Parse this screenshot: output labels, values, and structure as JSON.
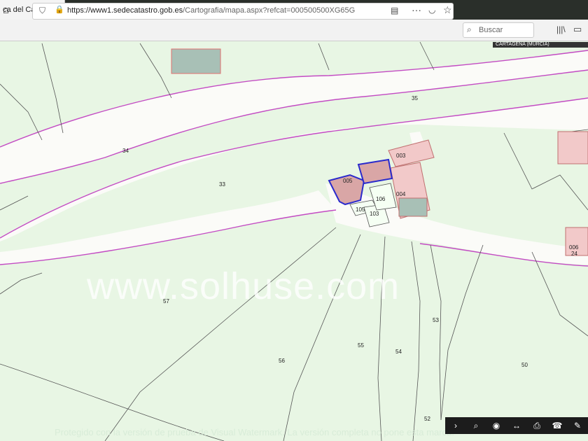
{
  "browser": {
    "tab_title": "ca del Catastro",
    "tab_close": "×",
    "new_tab": "+",
    "url_host": "https://www1.sedecatastro.gob.es",
    "url_path": "/Cartografia/mapa.aspx?refcat=000500500XG65G",
    "search_placeholder": "Buscar",
    "icons": [
      "home-icon",
      "shield-icon",
      "lock-icon",
      "reader-icon",
      "more-icon",
      "pocket-icon",
      "star-icon",
      "search-icon",
      "library-icon",
      "sidebar-icon"
    ]
  },
  "map": {
    "municipality": "CARTAGENA (MURCIA)",
    "parcels": [
      "35",
      "34",
      "33",
      "003",
      "005",
      "004",
      "106",
      "105",
      "103",
      "006",
      "24",
      "57",
      "53",
      "55",
      "54",
      "56",
      "50",
      "52"
    ],
    "watermark": "www.solhuse.com",
    "notice": "Protegido con la versión de prueba de Visual Watermark. La versión completa no pone esta marca.",
    "tools": [
      "›",
      "⌕",
      "◉",
      "↔",
      "⎙",
      "☎",
      "✎"
    ],
    "colors": {
      "land": "#e8f6e4",
      "road": "#fbfbf8",
      "border_road": "#c34bc3",
      "selected": "#2a2acc",
      "building": "#d9a6a6",
      "parcel_line": "#555555"
    }
  }
}
